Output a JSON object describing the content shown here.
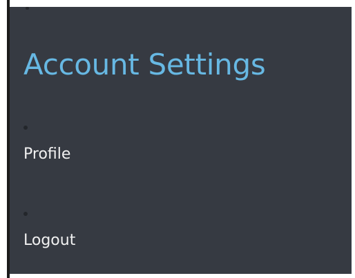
{
  "app": {
    "title": "Account Settings"
  },
  "menu": {
    "items": [
      {
        "label": "Profile"
      },
      {
        "label": "Logout"
      }
    ]
  },
  "colors": {
    "background": "#363a42",
    "title": "#67b8e3",
    "text": "#f1f1f1",
    "bullet": "#23262b",
    "edge": "#1b1b1b"
  }
}
